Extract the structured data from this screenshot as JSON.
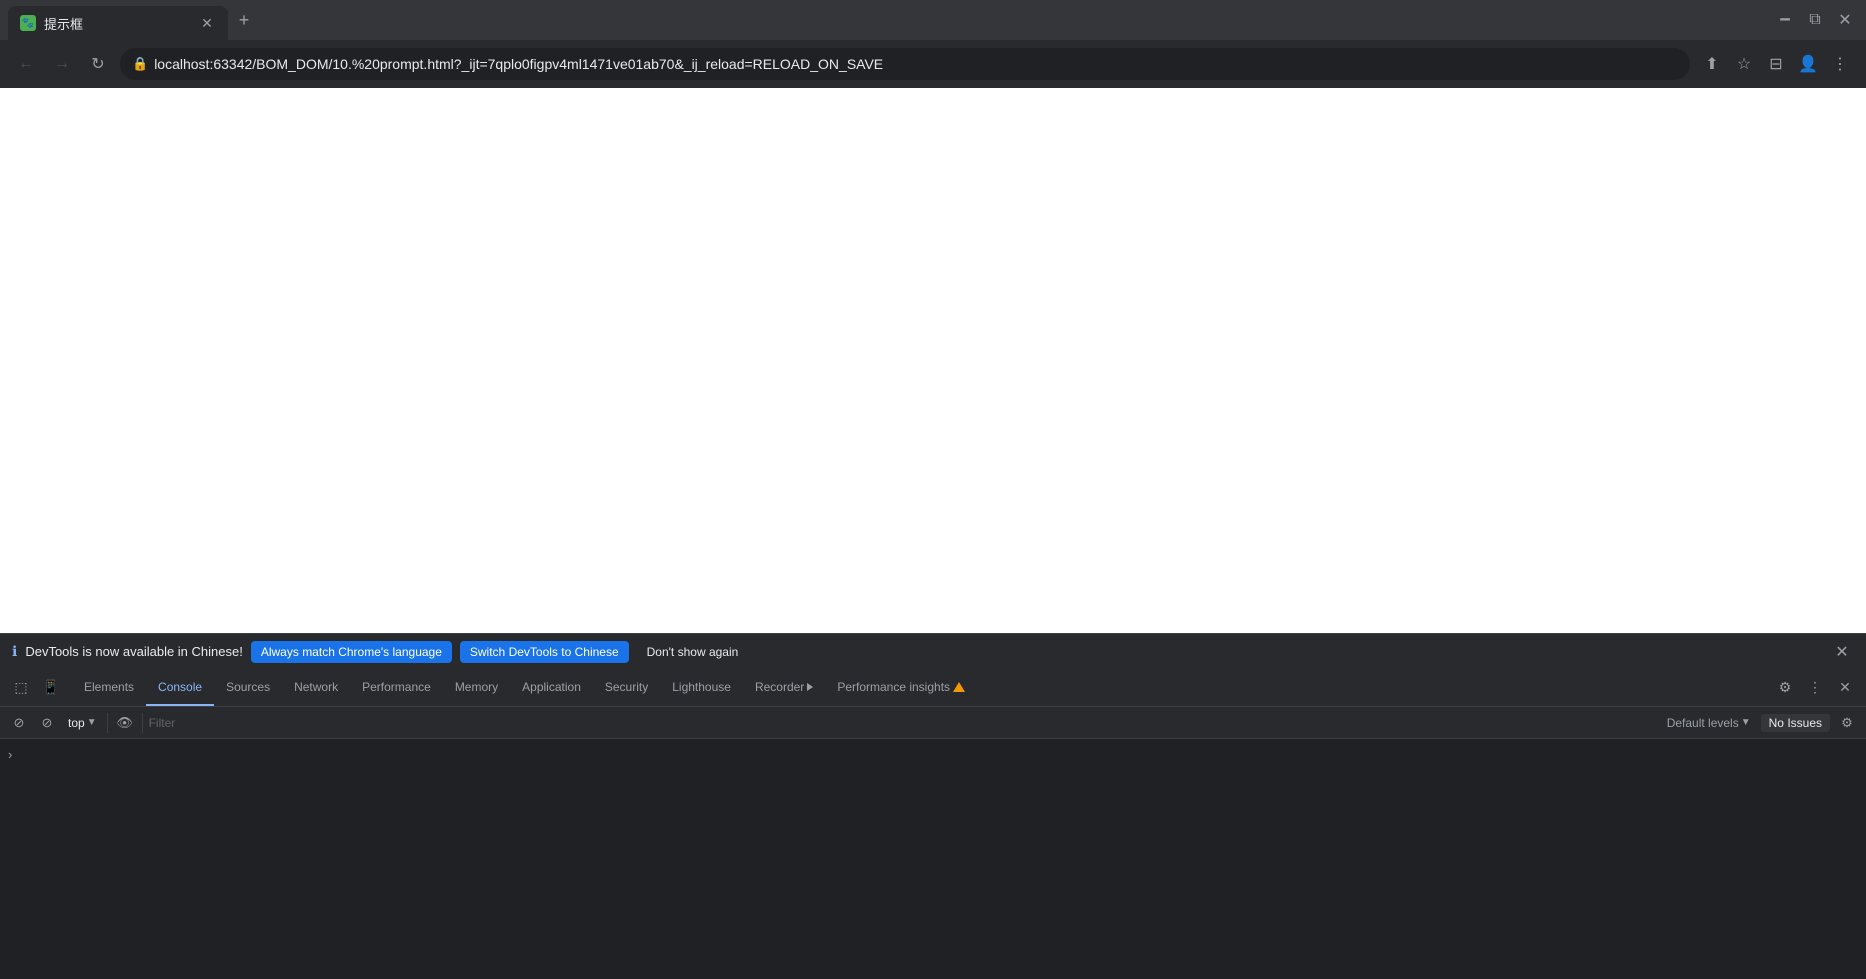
{
  "browser": {
    "title": "提示框",
    "tab_favicon_label": "🐾",
    "url": "localhost:63342/BOM_DOM/10.%20prompt.html?_ijt=7qplo0figpv4ml1471ve01ab70&_ij_reload=RELOAD_ON_SAVE",
    "new_tab_label": "+",
    "win_controls": {
      "minimize": "─",
      "maximize": "□",
      "restore": "⧉",
      "close": "✕"
    }
  },
  "devtools": {
    "banner": {
      "info_text": "DevTools is now available in Chinese!",
      "btn1_label": "Always match Chrome's language",
      "btn2_label": "Switch DevTools to Chinese",
      "btn3_label": "Don't show again"
    },
    "tabs": [
      {
        "id": "elements",
        "label": "Elements",
        "active": false
      },
      {
        "id": "console",
        "label": "Console",
        "active": true
      },
      {
        "id": "sources",
        "label": "Sources",
        "active": false
      },
      {
        "id": "network",
        "label": "Network",
        "active": false
      },
      {
        "id": "performance",
        "label": "Performance",
        "active": false
      },
      {
        "id": "memory",
        "label": "Memory",
        "active": false
      },
      {
        "id": "application",
        "label": "Application",
        "active": false
      },
      {
        "id": "security",
        "label": "Security",
        "active": false
      },
      {
        "id": "lighthouse",
        "label": "Lighthouse",
        "active": false
      },
      {
        "id": "recorder",
        "label": "Recorder",
        "active": false
      },
      {
        "id": "performance-insights",
        "label": "Performance insights",
        "active": false
      }
    ],
    "console": {
      "top_label": "top",
      "filter_placeholder": "Filter",
      "default_levels_label": "Default levels",
      "no_issues_label": "No Issues"
    }
  }
}
